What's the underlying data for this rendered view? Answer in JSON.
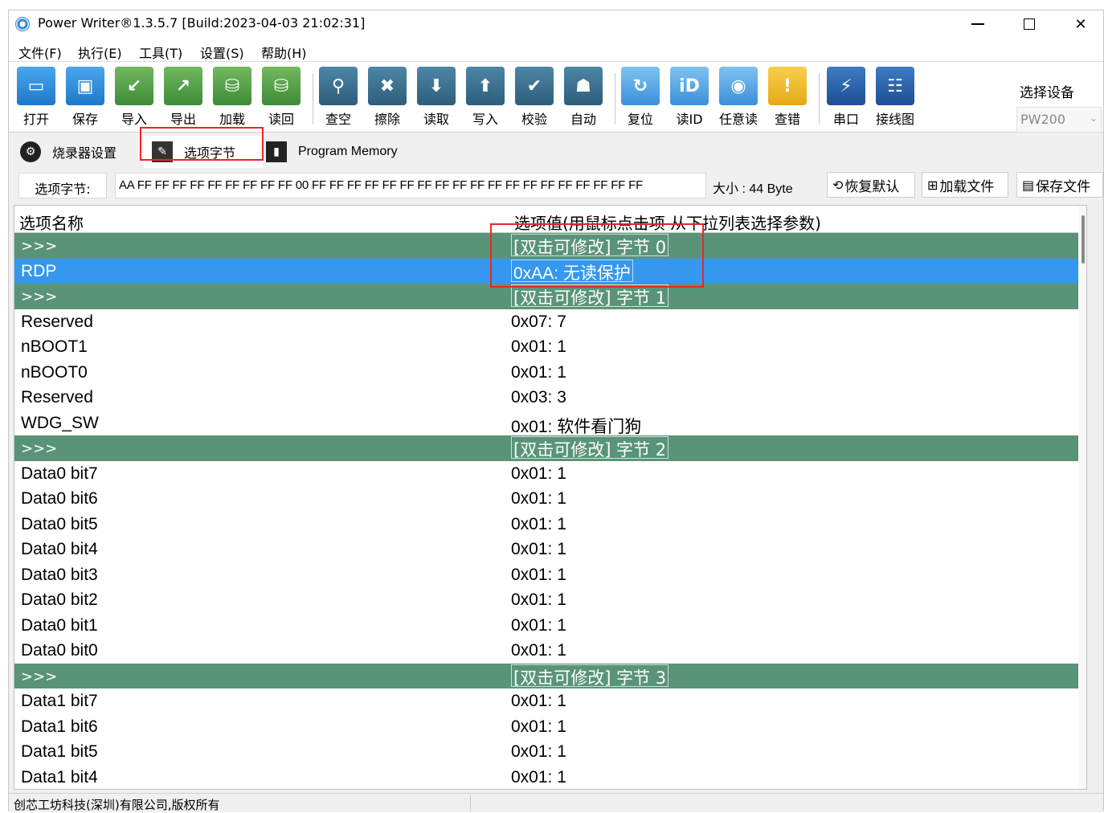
{
  "window": {
    "title": "Power Writer®1.3.5.7 [Build:2023-04-03 21:02:31]"
  },
  "menu": [
    "文件(F)",
    "执行(E)",
    "工具(T)",
    "设置(S)",
    "帮助(H)"
  ],
  "toolbar": {
    "buttons": [
      {
        "label": "打开",
        "icon": "folder-open-icon",
        "color": "#2b8ee0"
      },
      {
        "label": "保存",
        "icon": "save-icon",
        "color": "#2b8ee0"
      },
      {
        "label": "导入",
        "icon": "import-icon",
        "color": "#4fa04a"
      },
      {
        "label": "导出",
        "icon": "export-icon",
        "color": "#4fa04a"
      },
      {
        "label": "加载",
        "icon": "load-icon",
        "color": "#3d8c37"
      },
      {
        "label": "读回",
        "icon": "readback-icon",
        "color": "#3d8c37"
      },
      {
        "label": "查空",
        "icon": "search-icon",
        "color": "#2c5e7a"
      },
      {
        "label": "擦除",
        "icon": "erase-icon",
        "color": "#2c5e7a"
      },
      {
        "label": "读取",
        "icon": "read-icon",
        "color": "#2c5e7a"
      },
      {
        "label": "写入",
        "icon": "write-icon",
        "color": "#2c5e7a"
      },
      {
        "label": "校验",
        "icon": "verify-icon",
        "color": "#2c5e7a"
      },
      {
        "label": "自动",
        "icon": "robot-icon",
        "color": "#2c5e7a"
      },
      {
        "label": "复位",
        "icon": "reset-icon",
        "color": "#3d8fd8"
      },
      {
        "label": "读ID",
        "icon": "id-icon",
        "color": "#3d8fd8"
      },
      {
        "label": "任意读",
        "icon": "read-any-icon",
        "color": "#3d8fd8"
      },
      {
        "label": "查错",
        "icon": "warning-icon",
        "color": "#e6a817"
      },
      {
        "label": "串口",
        "icon": "serial-port-icon",
        "color": "#1d4f94"
      },
      {
        "label": "接线图",
        "icon": "wiring-diagram-icon",
        "color": "#1d4f94"
      }
    ],
    "device_label": "选择设备",
    "device_value": "PW200"
  },
  "tabs": [
    {
      "label": "烧录器设置",
      "icon": "gear-icon"
    },
    {
      "label": "选项字节",
      "icon": "option-bytes-icon"
    },
    {
      "label": "Program Memory",
      "icon": "memory-icon"
    }
  ],
  "option_bytes": {
    "label": "选项字节:",
    "bytes": "AA FF FF FF FF FF FF FF FF FF 00 FF FF FF FF FF FF FF FF FF FF FF FF FF FF FF FF FF FF FF",
    "size": "大小 : 44 Byte",
    "restore_button": "恢复默认",
    "load_button": "加载文件",
    "save_button": "保存文件"
  },
  "grid": {
    "col_name": "选项名称",
    "col_value": "选项值(用鼠标点击项 从下拉列表选择参数)",
    "rows": [
      {
        "name": ">>>",
        "value": "[双击可修改] 字节 0",
        "type": "group"
      },
      {
        "name": "RDP",
        "value": "0xAA: 无读保护",
        "type": "selected"
      },
      {
        "name": ">>>",
        "value": "[双击可修改] 字节 1",
        "type": "group"
      },
      {
        "name": "Reserved",
        "value": "0x07: 7",
        "type": "normal"
      },
      {
        "name": "nBOOT1",
        "value": "0x01: 1",
        "type": "normal"
      },
      {
        "name": "nBOOT0",
        "value": "0x01: 1",
        "type": "normal"
      },
      {
        "name": "Reserved",
        "value": "0x03: 3",
        "type": "normal"
      },
      {
        "name": "WDG_SW",
        "value": "0x01: 软件看门狗",
        "type": "normal"
      },
      {
        "name": ">>>",
        "value": "[双击可修改] 字节 2",
        "type": "group"
      },
      {
        "name": "Data0 bit7",
        "value": "0x01: 1",
        "type": "normal"
      },
      {
        "name": "Data0 bit6",
        "value": "0x01: 1",
        "type": "normal"
      },
      {
        "name": "Data0 bit5",
        "value": "0x01: 1",
        "type": "normal"
      },
      {
        "name": "Data0 bit4",
        "value": "0x01: 1",
        "type": "normal"
      },
      {
        "name": "Data0 bit3",
        "value": "0x01: 1",
        "type": "normal"
      },
      {
        "name": "Data0 bit2",
        "value": "0x01: 1",
        "type": "normal"
      },
      {
        "name": "Data0 bit1",
        "value": "0x01: 1",
        "type": "normal"
      },
      {
        "name": "Data0 bit0",
        "value": "0x01: 1",
        "type": "normal"
      },
      {
        "name": ">>>",
        "value": "[双击可修改] 字节 3",
        "type": "group"
      },
      {
        "name": "Data1 bit7",
        "value": "0x01: 1",
        "type": "normal"
      },
      {
        "name": "Data1 bit6",
        "value": "0x01: 1",
        "type": "normal"
      },
      {
        "name": "Data1 bit5",
        "value": "0x01: 1",
        "type": "normal"
      },
      {
        "name": "Data1 bit4",
        "value": "0x01: 1",
        "type": "normal"
      }
    ]
  },
  "status": {
    "text": "创芯工坊科技(深圳)有限公司,版权所有"
  },
  "colors": {
    "group_row": "#5a9478",
    "selected_row": "#3597ee",
    "highlight": "#e8262a"
  }
}
